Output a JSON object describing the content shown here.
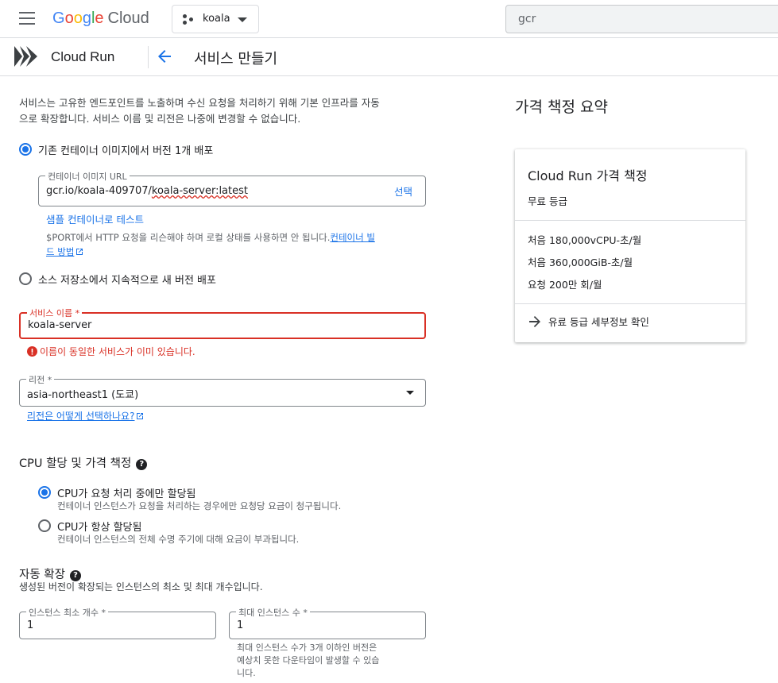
{
  "topbar": {
    "logo_letters": [
      "G",
      "o",
      "o",
      "g",
      "l",
      "e"
    ],
    "logo_cloud": "Cloud",
    "project": "koala",
    "search_value": "gcr"
  },
  "subbar": {
    "product": "Cloud Run",
    "page_title": "서비스 만들기"
  },
  "intro": {
    "line1": "서비스는 고유한 엔드포인트를 노출하며 수신 요청을 처리하기 위해 기본 인프라를 자동",
    "line2": "으로 확장합니다. 서비스 이름 및 리전은 나중에 변경할 수 없습니다."
  },
  "deploy": {
    "option1": "기존 컨테이너 이미지에서 버전 1개 배포",
    "image_label": "컨테이너 이미지 URL",
    "image_value_prefix": "gcr.io/koala-409707/",
    "image_value_underlined": "koala-server:latest",
    "select_button": "선택",
    "test_link": "샘플 컨테이너로 테스트",
    "port_note_pre": "$PORT에서 HTTP 요청을 리슨해야 하며 로컬 상태를 사용하면 안 됩니다.",
    "port_note_link1": "컨테이너 빌",
    "port_note_link2": "드 방법",
    "option2": "소스 저장소에서 지속적으로 새 버전 배포"
  },
  "service_name": {
    "label": "서비스 이름 *",
    "value": "koala-server",
    "error": "이름이 동일한 서비스가 이미 있습니다."
  },
  "region": {
    "label": "리전 *",
    "value": "asia-northeast1 (도쿄)",
    "help_link": "리전은 어떻게 선택하나요?"
  },
  "cpu": {
    "title": "CPU 할당 및 가격 책정",
    "opt1_title": "CPU가 요청 처리 중에만 할당됨",
    "opt1_desc": "컨테이너 인스턴스가 요청을 처리하는 경우에만 요청당 요금이 청구됩니다.",
    "opt2_title": "CPU가 항상 할당됨",
    "opt2_desc": "컨테이너 인스턴스의 전체 수명 주기에 대해 요금이 부과됩니다."
  },
  "autoscale": {
    "title": "자동 확장",
    "desc": "생성된 버전이 확장되는 인스턴스의 최소 및 최대 개수입니다.",
    "min_label": "인스턴스 최소 개수 *",
    "min_value": "1",
    "max_label": "최대 인스턴스 수 *",
    "max_value": "1",
    "note1": "최대 인스턴스 수가 3개 이하인 버전은",
    "note2": "예상치 못한 다운타임이 발생할 수 있습",
    "note3": "니다."
  },
  "pricing": {
    "title": "가격 책정 요약",
    "card_title": "Cloud Run 가격 책정",
    "tier": "무료 등급",
    "items": [
      "처음 180,000vCPU-초/월",
      "처음 360,000GiB-초/월",
      "요청 200만 회/월"
    ],
    "more": "유료 등급 세부정보 확인"
  },
  "colors": {
    "primary": "#1a73e8",
    "error": "#d93025",
    "text": "#202124"
  }
}
